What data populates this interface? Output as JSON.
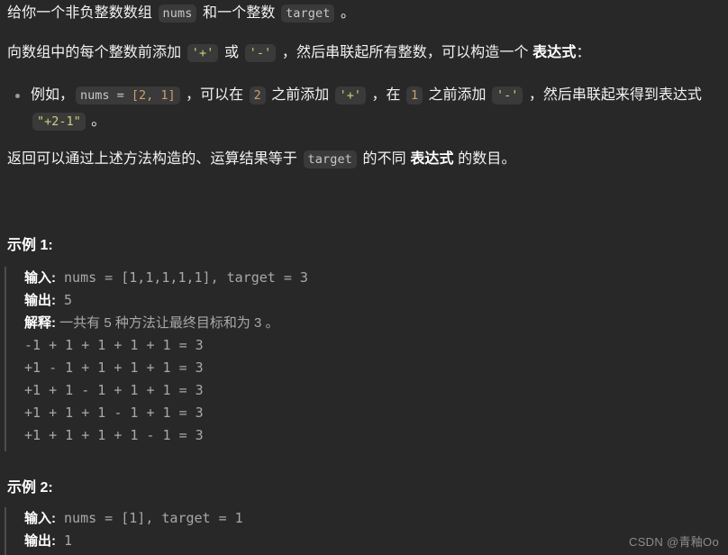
{
  "theme": {
    "background": "#282828",
    "text": "#f2f2f2",
    "code_chip_bg": "#3a3a3a",
    "code_text": "#c8c8c8",
    "muted_text": "#a8a8a8",
    "quote_border": "#4d4d4d",
    "string_token": "#cfcf7a",
    "number_token": "#c9a06a",
    "watermark": "#8c8c8c"
  },
  "paragraph1": {
    "part1": "给你一个非负整数数组 ",
    "code_nums": "nums",
    "part2": " 和一个整数 ",
    "code_target": "target",
    "part3": " 。"
  },
  "paragraph2": {
    "part1": "向数组中的每个整数前添加 ",
    "code_plus": "'+'",
    "part2": " 或 ",
    "code_minus": "'-'",
    "part3": " ，然后串联起所有整数，可以构造一个 ",
    "bold": "表达式",
    "part4": "："
  },
  "bullet": {
    "part1": "例如，",
    "code_assign_nums": "nums",
    "code_assign_op": " = ",
    "code_assign_val": "[2, 1]",
    "part2": " ，可以在 ",
    "code_two": "2",
    "part3": " 之前添加 ",
    "code_plus": "'+'",
    "part4": " ，在 ",
    "code_one": "1",
    "part5": " 之前添加 ",
    "code_minus": "'-'",
    "part6": " ，然后串联起来得到表达式 ",
    "code_expr": "\"+2-1\"",
    "part7": " 。"
  },
  "paragraph3": {
    "part1": "返回可以通过上述方法构造的、运算结果等于 ",
    "code_target": "target",
    "part2": " 的不同 ",
    "bold": "表达式",
    "part3": " 的数目。"
  },
  "example1": {
    "heading": "示例 1:",
    "input_label": "输入:",
    "input_value": " nums = [1,1,1,1,1], target = 3",
    "output_label": "输出:",
    "output_value": " 5",
    "explain_label": "解释:",
    "explain_value": " 一共有 5 种方法让最终目标和为 3 。",
    "equations": [
      "-1 + 1 + 1 + 1 + 1 = 3",
      "+1 - 1 + 1 + 1 + 1 = 3",
      "+1 + 1 - 1 + 1 + 1 = 3",
      "+1 + 1 + 1 - 1 + 1 = 3",
      "+1 + 1 + 1 + 1 - 1 = 3"
    ]
  },
  "example2": {
    "heading": "示例 2:",
    "input_label": "输入:",
    "input_value": " nums = [1], target = 1",
    "output_label": "输出:",
    "output_value": " 1"
  },
  "watermark": {
    "text": "CSDN @青釉Oo"
  }
}
